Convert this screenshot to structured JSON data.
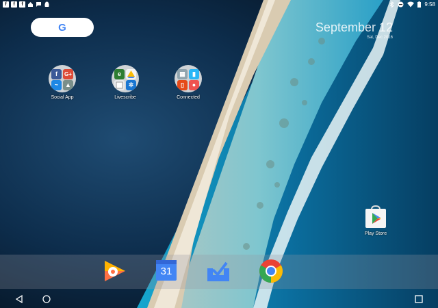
{
  "status_bar": {
    "time": "9:58",
    "left_icons": [
      "facebook-icon",
      "facebook-icon",
      "facebook-icon",
      "home-icon",
      "chat-icon",
      "android-icon"
    ],
    "right_icons": [
      "bluetooth-icon",
      "do-not-disturb-icon",
      "wifi-icon",
      "battery-icon"
    ]
  },
  "search": {
    "logo": "G"
  },
  "date_widget": {
    "date": "September 12",
    "subtitle": "Sat, Dec 2016"
  },
  "folders": [
    {
      "label": "Social App"
    },
    {
      "label": "Livescribe"
    },
    {
      "label": "Connected"
    }
  ],
  "desktop_apps": [
    {
      "label": "Play Store"
    }
  ],
  "calendar_day": "31",
  "dock_icons": [
    "play-music-icon",
    "calendar-icon",
    "inbox-icon",
    "chrome-icon"
  ],
  "nav": [
    "back-icon",
    "home-icon",
    "recents-icon"
  ],
  "colors": {
    "google_blue": "#4285F4",
    "google_red": "#EA4335",
    "google_yellow": "#FBBC05",
    "google_green": "#34A853"
  }
}
